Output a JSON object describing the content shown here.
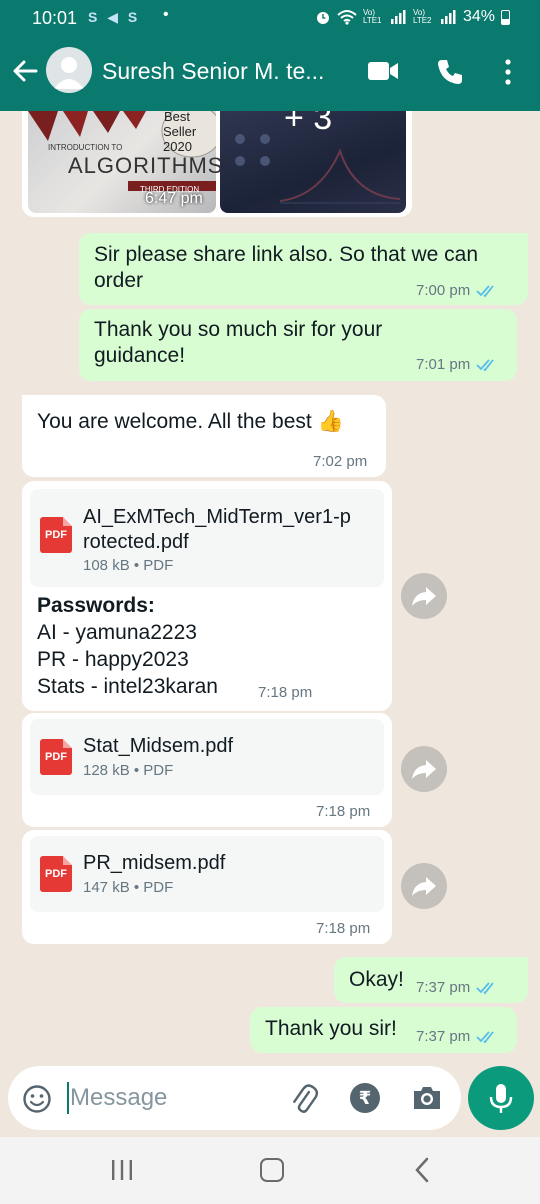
{
  "status_bar": {
    "time": "10:01",
    "left_icons": "S ◀ S",
    "dot": "•",
    "network_1": "Vo) LTE1",
    "network_2": "Vo) LTE2",
    "battery": "34%"
  },
  "header": {
    "contact_name": "Suresh Senior M. te...",
    "icons": [
      "back-arrow-icon",
      "avatar",
      "video-call-icon",
      "phone-icon",
      "more-icon"
    ]
  },
  "messages": {
    "images": {
      "book_text_1": "Best",
      "book_text_2": "Seller",
      "book_text_3": "2020",
      "book_sub": "INTRODUCTION TO",
      "book_title": "ALGORITHMS",
      "book_edition": "THIRD EDITION",
      "time": "6:47 pm",
      "more_count": "+ 3"
    },
    "out_1": {
      "text": "Sir please share link also. So that we can order",
      "time": "7:00 pm"
    },
    "out_2": {
      "text": "Thank you so much sir for your guidance!",
      "time": "7:01 pm"
    },
    "in_1": {
      "text": "You are welcome. All the best 👍",
      "time": "7:02 pm"
    },
    "doc_1": {
      "file_name": "AI_ExMTech_MidTerm_ver1-protected.pdf",
      "file_name_line1": "AI_ExMTech_MidTerm_ver1-p",
      "file_name_line2": "rotected.pdf",
      "info": "108 kB • PDF",
      "pdf_label": "PDF",
      "caption_title": "Passwords:",
      "caption_line1": "AI - yamuna2223",
      "caption_line2": "PR - happy2023",
      "caption_line3": "Stats - intel23karan",
      "time": "7:18 pm"
    },
    "doc_2": {
      "file_name": "Stat_Midsem.pdf",
      "info": "128 kB • PDF",
      "pdf_label": "PDF",
      "time": "7:18 pm"
    },
    "doc_3": {
      "file_name": "PR_midsem.pdf",
      "info": "147 kB • PDF",
      "pdf_label": "PDF",
      "time": "7:18 pm"
    },
    "out_3": {
      "text": "Okay!",
      "time": "7:37 pm"
    },
    "out_4": {
      "text": "Thank you sir!",
      "time": "7:37 pm"
    }
  },
  "composer": {
    "placeholder": "Message",
    "rupee_symbol": "₹"
  },
  "colors": {
    "header": "#0b7a6e",
    "outgoing_bubble": "#d9fdd3",
    "incoming_bubble": "#ffffff",
    "read_ticks": "#53bdeb",
    "mic_button": "#0b9b7c",
    "pdf_icon": "#e53935"
  }
}
